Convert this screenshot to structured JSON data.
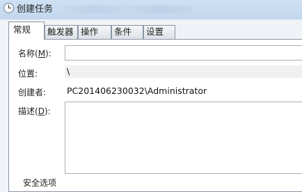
{
  "window": {
    "title": "创建任务",
    "subtitle": ""
  },
  "tabs": [
    {
      "label": "常规",
      "active": true
    },
    {
      "label": "触发器",
      "active": false
    },
    {
      "label": "操作",
      "active": false
    },
    {
      "label": "条件",
      "active": false
    },
    {
      "label": "设置",
      "active": false
    }
  ],
  "form": {
    "name": {
      "label_text": "名称(",
      "accel": "M",
      "label_close": "):",
      "value": ""
    },
    "location": {
      "label": "位置:",
      "value": "\\"
    },
    "author": {
      "label": "创建者:",
      "value": "PC201406230032\\Administrator"
    },
    "description": {
      "label_text": "描述(",
      "accel": "D",
      "label_close": "):",
      "value": ""
    }
  },
  "next_section": {
    "label": "安全选项"
  }
}
